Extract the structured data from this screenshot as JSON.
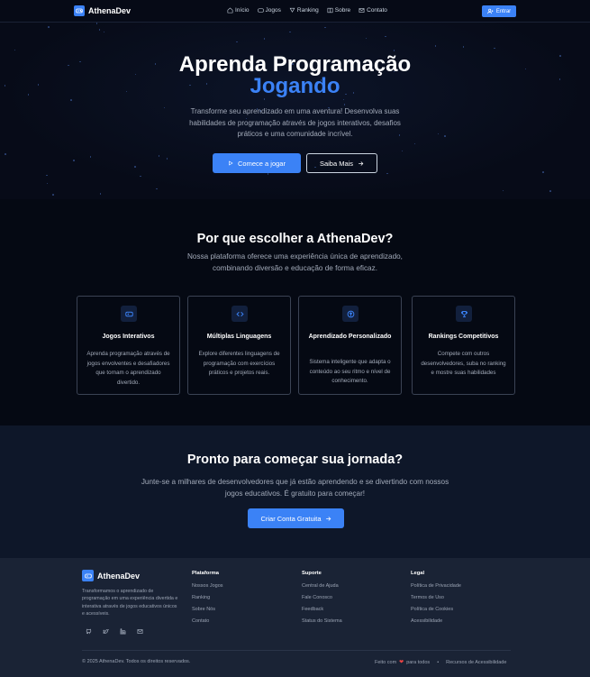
{
  "nav": {
    "brand": "AthenaDev",
    "links": [
      {
        "label": "Início",
        "icon": "home-icon"
      },
      {
        "label": "Jogos",
        "icon": "gamepad-icon"
      },
      {
        "label": "Ranking",
        "icon": "trophy-icon"
      },
      {
        "label": "Sobre",
        "icon": "book-icon"
      },
      {
        "label": "Contato",
        "icon": "mail-icon"
      }
    ],
    "login_label": "Entrar"
  },
  "hero": {
    "title_line1": "Aprenda Programação",
    "title_line2": "Jogando",
    "description": "Transforme seu aprendizado em uma aventura! Desenvolva suas habilidades de programação através de jogos interativos, desafios práticos e uma comunidade incrível.",
    "primary_button": "Comece a jogar",
    "secondary_button": "Saiba Mais"
  },
  "why": {
    "title": "Por que escolher a AthenaDev?",
    "description": "Nossa plataforma oferece uma experiência única de aprendizado, combinando diversão e educação de forma eficaz.",
    "cards": [
      {
        "title": "Jogos Interativos",
        "icon": "gamepad-icon",
        "description": "Aprenda programação através de jogos envolventes e desafiadores que tornam o aprendizado divertido."
      },
      {
        "title": "Múltiplas Linguagens",
        "icon": "code-icon",
        "description": "Explore diferentes linguagens de programação com exercícios práticos e projetos reais."
      },
      {
        "title": "Aprendizado Personalizado",
        "icon": "brain-icon",
        "description": "Sistema inteligente que adapta o conteúdo ao seu ritmo e nível de conhecimento."
      },
      {
        "title": "Rankings Competitivos",
        "icon": "trophy-icon",
        "description": "Compete com outros desenvolvedores, suba no ranking e mostre suas habilidades"
      }
    ]
  },
  "cta": {
    "title": "Pronto para começar sua jornada?",
    "description": "Junte-se a milhares de desenvolvedores que já estão aprendendo e se divertindo com nossos jogos educativos. É gratuito para começar!",
    "button": "Criar Conta Gratuita"
  },
  "footer": {
    "brand": "AthenaDev",
    "description": "Transformamos o aprendizado de programação em uma experiência divertida e interativa através de jogos educativos únicos e acessíveis.",
    "columns": [
      {
        "title": "Plataforma",
        "items": [
          "Nossos Jogos",
          "Ranking",
          "Sobre Nós",
          "Contato"
        ]
      },
      {
        "title": "Suporte",
        "items": [
          "Central de Ajuda",
          "Fale Conosco",
          "Feedback",
          "Status do Sistema"
        ]
      },
      {
        "title": "Legal",
        "items": [
          "Política de Privacidade",
          "Termos de Uso",
          "Política de Cookies",
          "Acessibilidade"
        ]
      }
    ],
    "copyright": "© 2025 AthenaDev. Todos os direitos reservados.",
    "made_with_prefix": "Feito com",
    "made_with_suffix": "para todos",
    "accessibility_link": "Recursos de Acessibilidade"
  },
  "colors": {
    "accent": "#3b82f6",
    "background": "#070b18",
    "cta_bg": "#0e1729",
    "footer_bg": "#1a2335"
  }
}
